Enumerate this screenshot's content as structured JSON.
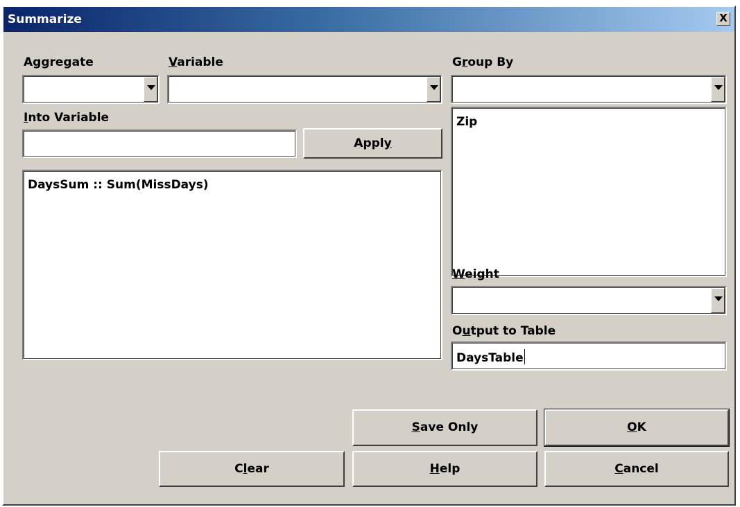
{
  "window": {
    "title": "Summarize",
    "close_label": "X"
  },
  "aggregate": {
    "label_pre": "A",
    "label_ul": "g",
    "label_post": "gregate",
    "value": ""
  },
  "variable": {
    "label_pre": "",
    "label_ul": "V",
    "label_post": "ariable",
    "value": ""
  },
  "into_variable": {
    "label_pre": "",
    "label_ul": "I",
    "label_post": "nto Variable",
    "value": ""
  },
  "apply_button": {
    "label_pre": "Appl",
    "label_ul": "y",
    "label_post": ""
  },
  "expressions": {
    "items": [
      "DaysSum :: Sum(MissDays)"
    ]
  },
  "group_by": {
    "label_pre": "G",
    "label_ul": "r",
    "label_post": "oup By",
    "value": "",
    "items": [
      "Zip"
    ]
  },
  "weight": {
    "label_pre": "",
    "label_ul": "W",
    "label_post": "eight",
    "value": ""
  },
  "output_table": {
    "label_pre": "O",
    "label_ul": "u",
    "label_post": "tput to Table",
    "value": "DaysTable"
  },
  "buttons": {
    "save_only": {
      "pre": "",
      "ul": "S",
      "post": "ave Only"
    },
    "ok": {
      "pre": "",
      "ul": "O",
      "post": "K"
    },
    "clear": {
      "pre": "C",
      "ul": "l",
      "post": "ear"
    },
    "help": {
      "pre": "",
      "ul": "H",
      "post": "elp"
    },
    "cancel": {
      "pre": "",
      "ul": "C",
      "post": "ancel"
    }
  }
}
